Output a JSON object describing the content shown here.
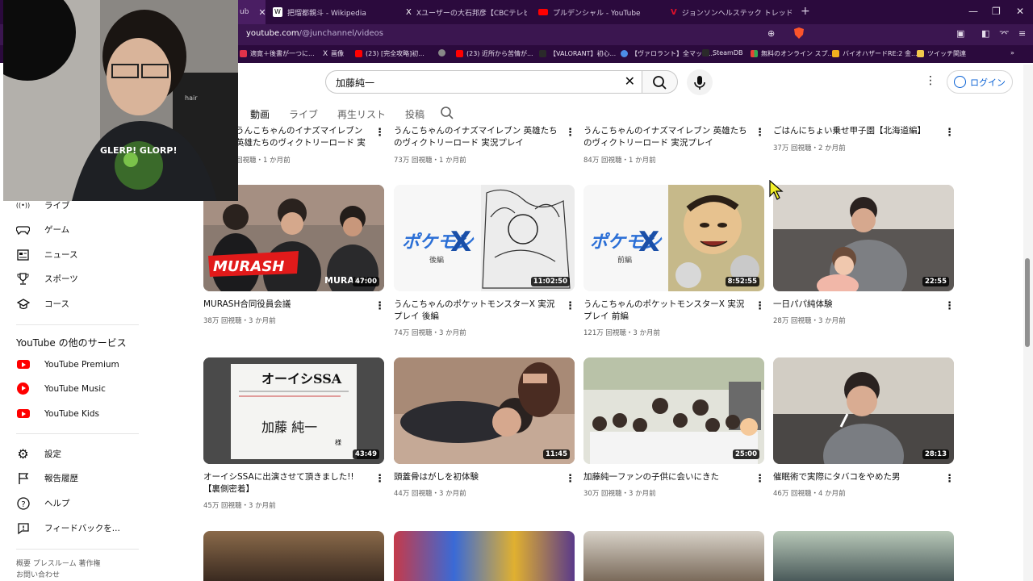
{
  "browser": {
    "tabs": [
      {
        "label": "ub",
        "fav": "#ff0000"
      },
      {
        "label": "把瑠都親斗 - Wikipedia",
        "fav": "#ffffff"
      },
      {
        "label": "Xユーザーの大石邦彦【CBCテレビ解説委",
        "fav": "#111111"
      },
      {
        "label": "プルデンシャル - YouTube",
        "fav": "#ff0000"
      },
      {
        "label": "ジョンソンヘルステック トレッドミル 業務用",
        "fav": "#c0102a"
      }
    ],
    "url_host": "youtube.com",
    "url_path": "/@junchannel/videos",
    "bookmarks": [
      {
        "label": "適寛＋後書が一つに...",
        "color": "#e2324a"
      },
      {
        "label": "画像",
        "color": "#111111"
      },
      {
        "label": "(23) [完全攻略]初...",
        "color": "#ff0000"
      },
      {
        "label": "",
        "color": "#888888"
      },
      {
        "label": "(23) 近所から苦情が...",
        "color": "#ff0000"
      },
      {
        "label": "【VALORANT】初心...",
        "color": "#2a2a2a"
      },
      {
        "label": "【ヴァロラント】全マップ...",
        "color": "#4d8de8"
      },
      {
        "label": "SteamDB",
        "color": "#2a2a2a"
      },
      {
        "label": "無料のオンライン スプ...",
        "color": "#34a853"
      },
      {
        "label": "バイオハザードRE:2 金...",
        "color": "#f2b01e"
      },
      {
        "label": "ツイッチ関連",
        "color": "#f2c94c"
      }
    ]
  },
  "header": {
    "search_value": "加藤純一",
    "login_label": "ログイン"
  },
  "channel_tabs": [
    "動画",
    "ライブ",
    "再生リスト",
    "投稿"
  ],
  "sidebar": {
    "items_top": [
      {
        "label": "ライブ",
        "icon": "live-icon",
        "glyph": "((•))"
      },
      {
        "label": "ゲーム",
        "icon": "gamepad-icon",
        "glyph": "🎮"
      },
      {
        "label": "ニュース",
        "icon": "news-icon",
        "glyph": "▤"
      },
      {
        "label": "スポーツ",
        "icon": "trophy-icon",
        "glyph": "🏆"
      },
      {
        "label": "コース",
        "icon": "course-icon",
        "glyph": "🎓"
      }
    ],
    "services_heading": "YouTube の他のサービス",
    "services": [
      {
        "label": "YouTube Premium",
        "icon": "youtube-premium-icon"
      },
      {
        "label": "YouTube Music",
        "icon": "youtube-music-icon"
      },
      {
        "label": "YouTube Kids",
        "icon": "youtube-kids-icon"
      }
    ],
    "settings": [
      {
        "label": "設定",
        "icon": "gear-icon",
        "glyph": "⚙"
      },
      {
        "label": "報告履歴",
        "icon": "flag-icon",
        "glyph": "⚑"
      },
      {
        "label": "ヘルプ",
        "icon": "help-icon",
        "glyph": "?"
      },
      {
        "label": "フィードバックを...",
        "icon": "feedback-icon",
        "glyph": "!"
      }
    ],
    "footer_line1": "概要  プレスルーム  著作権",
    "footer_line2": "お問い合わせ"
  },
  "videos_row0": [
    {
      "title": "うんこちゃんのイナズマイレブン 英雄たちのヴィクトリーロード 実況プレイPart3※...",
      "meta": "回視聴・1 か月前"
    },
    {
      "title": "うんこちゃんのイナズマイレブン 英雄たちのヴィクトリーロード 実況プレイPart2※...",
      "meta": "73万 回視聴・1 か月前"
    },
    {
      "title": "うんこちゃんのイナズマイレブン 英雄たちのヴィクトリーロード 実況プレイPart1※...",
      "meta": "84万 回視聴・1 か月前"
    },
    {
      "title": "ごはんにちょい乗せ甲子園【北海道編】",
      "meta": "37万 回視聴・2 か月前"
    }
  ],
  "videos_row1": [
    {
      "title": "MURASH合同役員会議",
      "meta": "38万 回視聴・3 か月前",
      "duration": "47:00"
    },
    {
      "title": "うんこちゃんのポケットモンスターX 実況プレイ 後編",
      "meta": "74万 回視聴・3 か月前",
      "duration": "11:02:50"
    },
    {
      "title": "うんこちゃんのポケットモンスターX 実況プレイ 前編",
      "meta": "121万 回視聴・3 か月前",
      "duration": "8:52:55"
    },
    {
      "title": "一日パパ純体験",
      "meta": "28万 回視聴・3 か月前",
      "duration": "22:55"
    }
  ],
  "videos_row2": [
    {
      "title": "オーイシSSAに出演させて頂きました!!【裏側密着】",
      "meta": "45万 回視聴・3 か月前",
      "duration": "43:49"
    },
    {
      "title": "頭蓋骨はがしを初体験",
      "meta": "44万 回視聴・3 か月前",
      "duration": "11:45"
    },
    {
      "title": "加藤純一ファンの子供に会いにきた",
      "meta": "30万 回視聴・3 か月前",
      "duration": "25:00"
    },
    {
      "title": "催眠術で実際にタバコをやめた男",
      "meta": "46万 回視聴・4 か月前",
      "duration": "28:13"
    }
  ],
  "thumb_text": {
    "murash": "MURASH",
    "pokemon_x": "X",
    "kouhen": "後編",
    "zenpen": "前編",
    "name_card": "加藤 純一",
    "name_card_suffix": "様",
    "shirt": "GLERP! GLORP!"
  },
  "colors": {
    "accent_link": "#065fd4",
    "browser_tabbar": "#2b0a3d",
    "youtube_red": "#ff0000"
  }
}
